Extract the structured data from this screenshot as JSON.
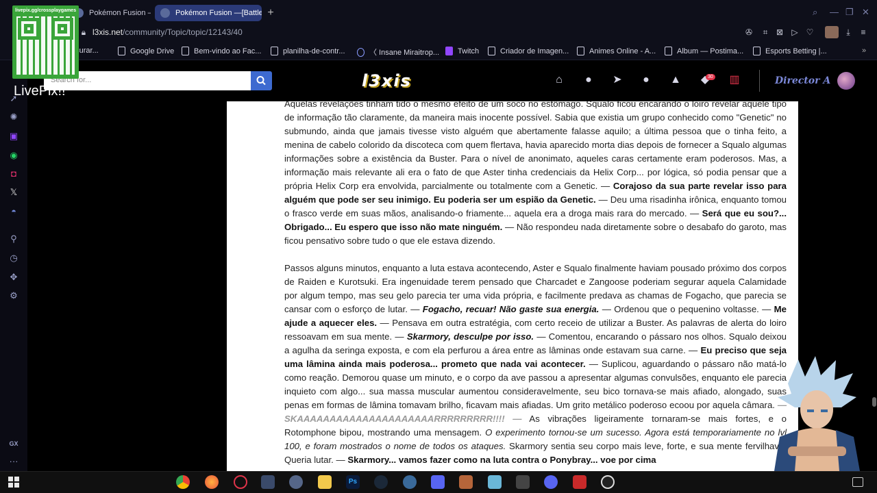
{
  "browser": {
    "tabs": [
      {
        "label": "Pokémon Fusion —[Battle",
        "active": false
      },
      {
        "label": "Pokémon Fusion —[Battle",
        "active": true
      }
    ],
    "url_host": "l3xis.net",
    "url_path": "/community/Topic/topic/12143/40",
    "bookmarks": [
      "ocurar...",
      "Google Drive",
      "Bem-vindo ao Fac...",
      "planilha-de-contr...",
      "〈 Insane Miraitrop...",
      "Twitch",
      "Criador de Imagen...",
      "Animes Online - A...",
      "Album — Postima...",
      "Esports Betting |..."
    ]
  },
  "overlay": {
    "qr_caption": "livepix.gg/crossplaygames",
    "livepix_label": "LivePix!!"
  },
  "site": {
    "search_placeholder": "Search for...",
    "logo_text": "l3xis",
    "notification_count": "30",
    "username": "Director A"
  },
  "article": {
    "p1": [
      {
        "t": "Aquelas revelações tinham tido o mesmo efeito de um soco no estômago. Squalo ficou encarando o loiro revelar aquele tipo de informação tão claramente, da maneira mais inocente possível. Sabia que existia um grupo conhecido como \"Genetic\" no submundo, ainda que jamais tivesse visto alguém que abertamente falasse aquilo; a última pessoa que o tinha feito, a menina de cabelo colorido da discoteca com quem flertava, havia aparecido morta dias depois de fornecer a Squalo algumas informações sobre a existência da Buster. Para o nível de anonimato, aqueles caras certamente eram poderosos. Mas, a informação mais relevante ali era o fato de que Aster tinha credenciais da Helix Corp... por lógica, só podia pensar que a própria Helix Corp era envolvida, parcialmente ou totalmente com a Genetic. — ",
        "s": "n"
      },
      {
        "t": "Corajoso da sua parte revelar isso para alguém que pode ser seu inimigo. Eu poderia ser um espião da Genetic.",
        "s": "b"
      },
      {
        "t": " — Deu uma risadinha irônica, enquanto tomou o frasco verde em suas mãos, analisando-o friamente... aquela era a droga mais rara do mercado. — ",
        "s": "n"
      },
      {
        "t": "Será que eu sou?... Obrigado... Eu espero que isso não mate ninguém.",
        "s": "b"
      },
      {
        "t": " — Não respondeu nada diretamente sobre o desabafo do garoto, mas ficou pensativo sobre tudo o que ele estava dizendo.",
        "s": "n"
      }
    ],
    "p2": [
      {
        "t": "Passos alguns minutos, enquanto a luta estava acontecendo, Aster e Squalo finalmente haviam pousado próximo dos corpos de Raiden e Kurotsuki. Era ingenuidade terem pensado que Charcadet e Zangoose poderiam segurar aquela Calamidade por algum tempo, mas seu gelo parecia ter uma vida própria, e facilmente predava as chamas de Fogacho, que parecia se cansar com o esforço de lutar. — ",
        "s": "n"
      },
      {
        "t": "Fogacho, recuar! Não gaste sua energia.",
        "s": "bi"
      },
      {
        "t": " — Ordenou que o pequenino voltasse. — ",
        "s": "n"
      },
      {
        "t": "Me ajude a aquecer eles.",
        "s": "b"
      },
      {
        "t": " — Pensava em outra estratégia, com certo receio de utilizar a Buster. As palavras de alerta do loiro ressoavam em sua mente. — ",
        "s": "n"
      },
      {
        "t": "Skarmory, desculpe por isso.",
        "s": "bi"
      },
      {
        "t": " — Comentou, encarando o pássaro nos olhos. Squalo deixou a agulha da seringa exposta, e com ela perfurou a área entre as lâminas onde estavam sua carne. — ",
        "s": "n"
      },
      {
        "t": "Eu preciso que seja uma lâmina ainda mais poderosa... prometo que nada vai acontecer.",
        "s": "b"
      },
      {
        "t": " — Suplicou, aguardando o pássaro não matá-lo como reação. Demorou quase um minuto, e o corpo da ave passou a apresentar algumas convulsões, enquanto ele parecia inquieto com algo... sua massa muscular aumentou consideravelmente, seu bico tornava-se mais afiado, alongado, suas penas em formas de lâmina tomavam brilho, ficavam mais afiadas. Um grito metálico poderoso ecoou por aquela câmara. ",
        "s": "n"
      },
      {
        "t": "— SKAAAAAAAAAAAAAAAAAAAAARRRRRRRRR!!!! —",
        "s": "gi"
      },
      {
        "t": " As vibrações ligeiramente tornaram-se mais fortes, e o Rotomphone bipou, mostrando uma mensagem. ",
        "s": "n"
      },
      {
        "t": "O experimento tornou-se um sucesso. Agora está temporariamente no lvl 100, e foram mostrados o nome de todos os ataques.",
        "s": "i"
      },
      {
        "t": " Skarmory sentia seu corpo mais leve, forte, e sua mente fervilhava. Queria lutar. — ",
        "s": "n"
      },
      {
        "t": "Skarmory... vamos fazer como na luta contra o Ponybray... voe por cima",
        "s": "b"
      }
    ]
  }
}
